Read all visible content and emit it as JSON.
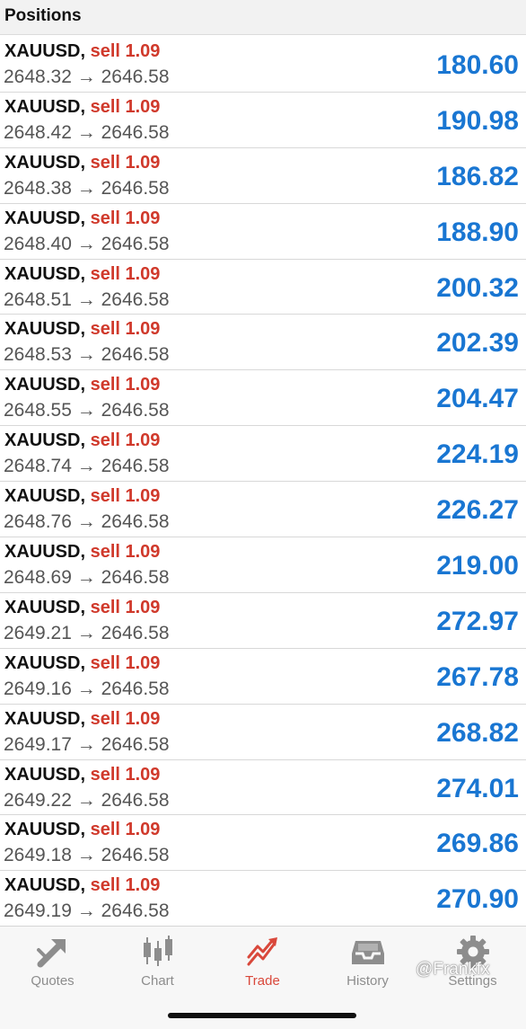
{
  "header": {
    "title": "Positions"
  },
  "positions": [
    {
      "symbol": "XAUUSD,",
      "side": "sell 1.09",
      "open": "2648.32",
      "arrow": "→",
      "current": "2646.58",
      "profit": "180.60"
    },
    {
      "symbol": "XAUUSD,",
      "side": "sell 1.09",
      "open": "2648.42",
      "arrow": "→",
      "current": "2646.58",
      "profit": "190.98"
    },
    {
      "symbol": "XAUUSD,",
      "side": "sell 1.09",
      "open": "2648.38",
      "arrow": "→",
      "current": "2646.58",
      "profit": "186.82"
    },
    {
      "symbol": "XAUUSD,",
      "side": "sell 1.09",
      "open": "2648.40",
      "arrow": "→",
      "current": "2646.58",
      "profit": "188.90"
    },
    {
      "symbol": "XAUUSD,",
      "side": "sell 1.09",
      "open": "2648.51",
      "arrow": "→",
      "current": "2646.58",
      "profit": "200.32"
    },
    {
      "symbol": "XAUUSD,",
      "side": "sell 1.09",
      "open": "2648.53",
      "arrow": "→",
      "current": "2646.58",
      "profit": "202.39"
    },
    {
      "symbol": "XAUUSD,",
      "side": "sell 1.09",
      "open": "2648.55",
      "arrow": "→",
      "current": "2646.58",
      "profit": "204.47"
    },
    {
      "symbol": "XAUUSD,",
      "side": "sell 1.09",
      "open": "2648.74",
      "arrow": "→",
      "current": "2646.58",
      "profit": "224.19"
    },
    {
      "symbol": "XAUUSD,",
      "side": "sell 1.09",
      "open": "2648.76",
      "arrow": "→",
      "current": "2646.58",
      "profit": "226.27"
    },
    {
      "symbol": "XAUUSD,",
      "side": "sell 1.09",
      "open": "2648.69",
      "arrow": "→",
      "current": "2646.58",
      "profit": "219.00"
    },
    {
      "symbol": "XAUUSD,",
      "side": "sell 1.09",
      "open": "2649.21",
      "arrow": "→",
      "current": "2646.58",
      "profit": "272.97"
    },
    {
      "symbol": "XAUUSD,",
      "side": "sell 1.09",
      "open": "2649.16",
      "arrow": "→",
      "current": "2646.58",
      "profit": "267.78"
    },
    {
      "symbol": "XAUUSD,",
      "side": "sell 1.09",
      "open": "2649.17",
      "arrow": "→",
      "current": "2646.58",
      "profit": "268.82"
    },
    {
      "symbol": "XAUUSD,",
      "side": "sell 1.09",
      "open": "2649.22",
      "arrow": "→",
      "current": "2646.58",
      "profit": "274.01"
    },
    {
      "symbol": "XAUUSD,",
      "side": "sell 1.09",
      "open": "2649.18",
      "arrow": "→",
      "current": "2646.58",
      "profit": "269.86"
    },
    {
      "symbol": "XAUUSD,",
      "side": "sell 1.09",
      "open": "2649.19",
      "arrow": "→",
      "current": "2646.58",
      "profit": "270.90"
    }
  ],
  "tabbar": {
    "tabs": [
      {
        "label": "Quotes",
        "icon": "quotes-arrow-icon",
        "active": false
      },
      {
        "label": "Chart",
        "icon": "candlestick-icon",
        "active": false
      },
      {
        "label": "Trade",
        "icon": "trade-trend-icon",
        "active": true
      },
      {
        "label": "History",
        "icon": "inbox-tray-icon",
        "active": false
      },
      {
        "label": "Settings",
        "icon": "gear-icon",
        "active": false
      }
    ]
  },
  "watermark": "@Frankfx",
  "colors": {
    "profit": "#1976d2",
    "sell": "#d0392b",
    "active_tab": "#d9483b",
    "inactive_tab": "#8d8d8d"
  }
}
